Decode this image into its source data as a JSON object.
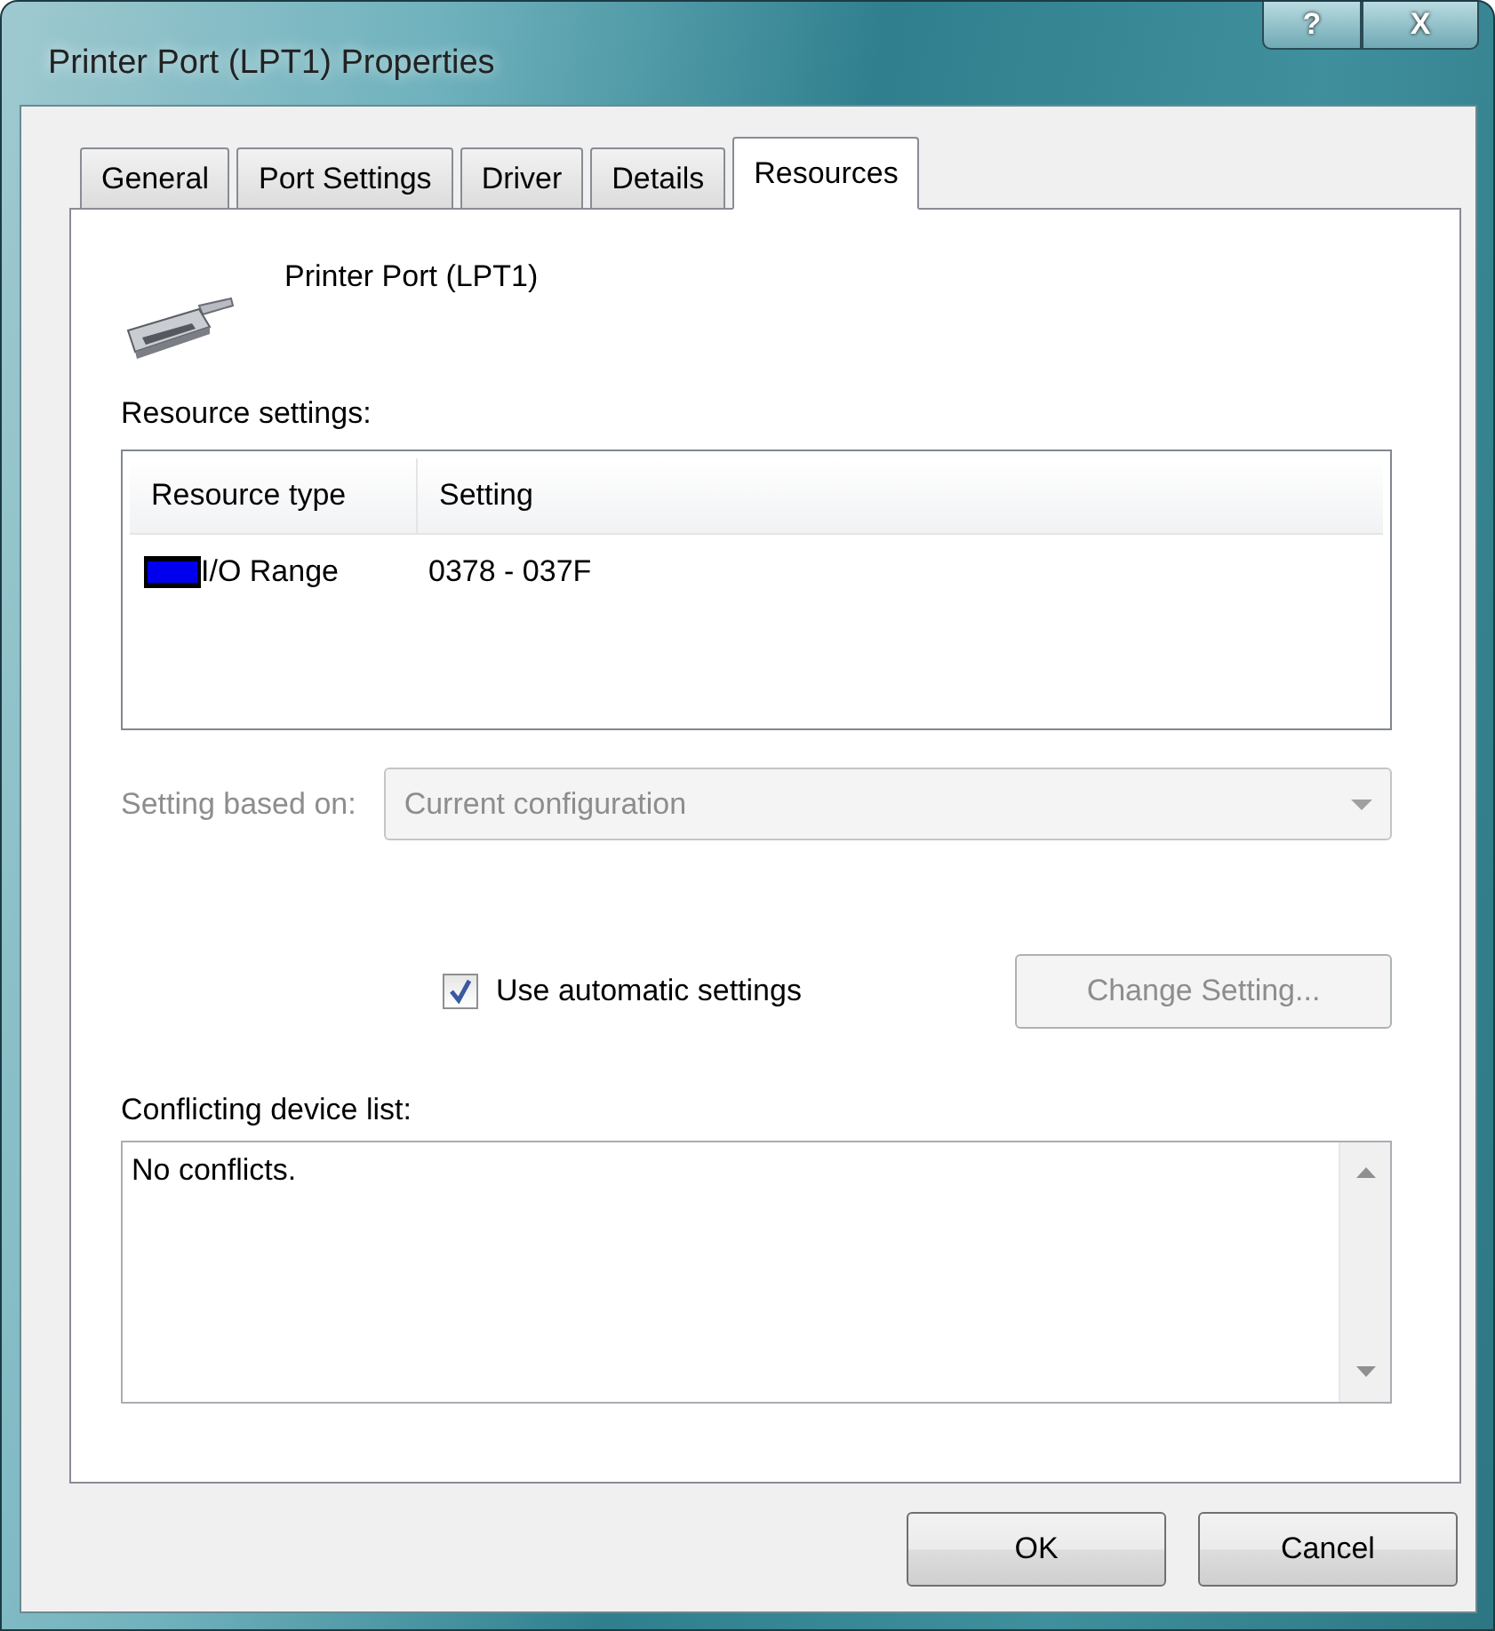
{
  "window": {
    "title": "Printer Port (LPT1) Properties",
    "controls": [
      {
        "kind": "help",
        "label": "?"
      },
      {
        "kind": "close",
        "label": "X"
      }
    ]
  },
  "tabs": [
    {
      "label": "General",
      "selected": false
    },
    {
      "label": "Port Settings",
      "selected": false
    },
    {
      "label": "Driver",
      "selected": false
    },
    {
      "label": "Details",
      "selected": false
    },
    {
      "label": "Resources",
      "selected": true
    }
  ],
  "device": {
    "name": "Printer Port (LPT1)"
  },
  "resource_settings": {
    "label": "Resource settings:",
    "columns": [
      "Resource type",
      "Setting"
    ],
    "rows": [
      {
        "type": "I/O Range",
        "setting": "0378 - 037F"
      }
    ]
  },
  "setting_based_on": {
    "label": "Setting based on:",
    "value": "Current configuration",
    "disabled": true
  },
  "automatic_settings": {
    "label": "Use automatic settings",
    "checked": true
  },
  "change_setting": {
    "label": "Change Setting...",
    "disabled": true
  },
  "conflicts": {
    "label": "Conflicting device list:",
    "text": "No conflicts."
  },
  "buttons": [
    "OK",
    "Cancel"
  ]
}
